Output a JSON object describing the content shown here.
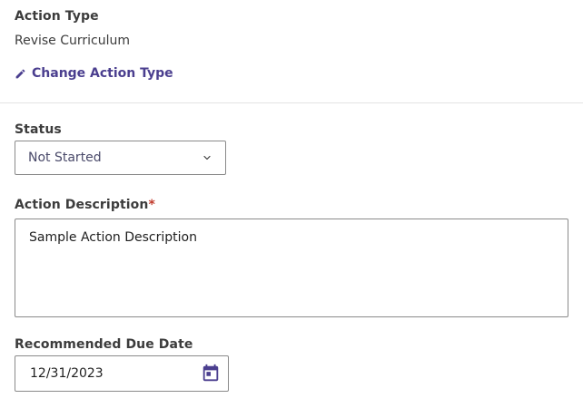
{
  "action_type": {
    "label": "Action Type",
    "value": "Revise Curriculum",
    "change_link": "Change Action Type"
  },
  "status": {
    "label": "Status",
    "selected": "Not Started"
  },
  "description": {
    "label": "Action Description",
    "required_marker": "*",
    "value": "Sample Action Description"
  },
  "due_date": {
    "label": "Recommended Due Date",
    "value": "12/31/2023"
  },
  "colors": {
    "link": "#4b3f8f",
    "calendar_icon": "#4b3f8f",
    "required": "#c0392b",
    "border": "#8a8a8a"
  },
  "icons": {
    "change_link": "pencil-icon",
    "status_dropdown": "chevron-down-icon",
    "due_date": "calendar-icon"
  }
}
